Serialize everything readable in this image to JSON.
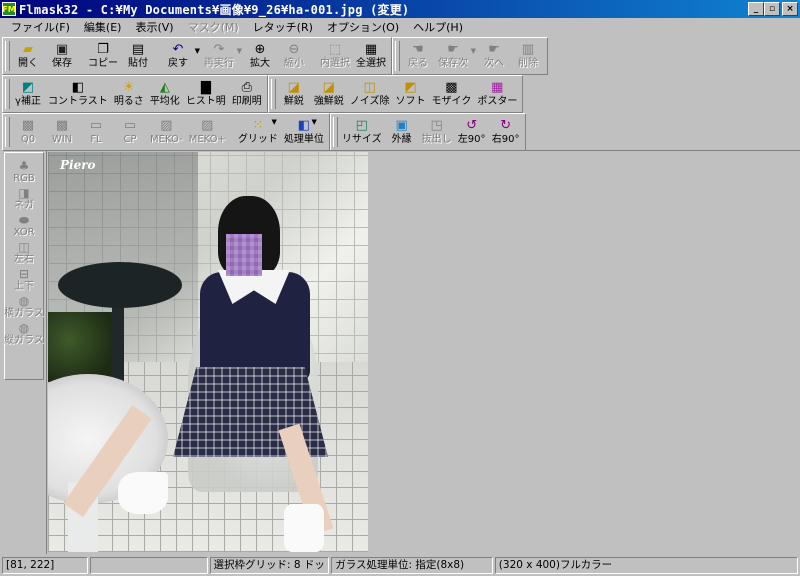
{
  "window": {
    "icon_text": "FM",
    "title": "Flmask32 - C:¥My Documents¥画像¥9_26¥ha-001.jpg (変更)",
    "btn_min": "_",
    "btn_max": "▫",
    "btn_close": "×"
  },
  "menu": [
    {
      "label": "ファイル(F)",
      "enabled": true
    },
    {
      "label": "編集(E)",
      "enabled": true
    },
    {
      "label": "表示(V)",
      "enabled": true
    },
    {
      "label": "マスク(M)",
      "enabled": false
    },
    {
      "label": "レタッチ(R)",
      "enabled": true
    },
    {
      "label": "オプション(O)",
      "enabled": true
    },
    {
      "label": "ヘルプ(H)",
      "enabled": true
    }
  ],
  "toolbar1": {
    "open": "開く",
    "save": "保存",
    "copy": "コピー",
    "paste": "貼付",
    "undo": "戻す",
    "redo": "再実行",
    "zoom_in": "拡大",
    "zoom_out": "縮小",
    "select_inner": "内選択",
    "select_all": "全選択",
    "back": "戻る",
    "save_next": "保存次",
    "next": "次へ",
    "delete": "削除"
  },
  "toolbar2": {
    "gamma": "γ補正",
    "contrast": "コントラスト",
    "brightness": "明るさ",
    "equalize": "平均化",
    "histogram": "ヒスト明",
    "print_bright": "印刷明",
    "sharpen": "鮮鋭",
    "strong_sharpen": "強鮮鋭",
    "denoise": "ノイズ除",
    "soft": "ソフト",
    "mosaic": "モザイク",
    "poster": "ポスター"
  },
  "toolbar3": {
    "q0": "Q0",
    "win": "WIN",
    "fl": "FL",
    "cp": "CP",
    "meko_minus": "MEKO-",
    "meko_plus": "MEKO+",
    "grid": "グリッド",
    "unit": "処理単位",
    "resize": "リサイズ",
    "outline": "外縁",
    "extract": "抜出し",
    "rotate_left": "左90°",
    "rotate_right": "右90°"
  },
  "sidebar": {
    "rgb": "RGB",
    "nega": "ネガ",
    "xor": "XOR",
    "lr": "左右",
    "ud": "上下",
    "hglass": "横ガラス",
    "vglass": "縦ガラス"
  },
  "image": {
    "watermark": "Piero",
    "width": 320,
    "height": 400
  },
  "status": {
    "coords": "[81, 222]",
    "grid": "選択枠グリッド: 8 ドット",
    "glass": "ガラス処理単位: 指定(8x8)",
    "size": "(320 x 400)フルカラー"
  }
}
